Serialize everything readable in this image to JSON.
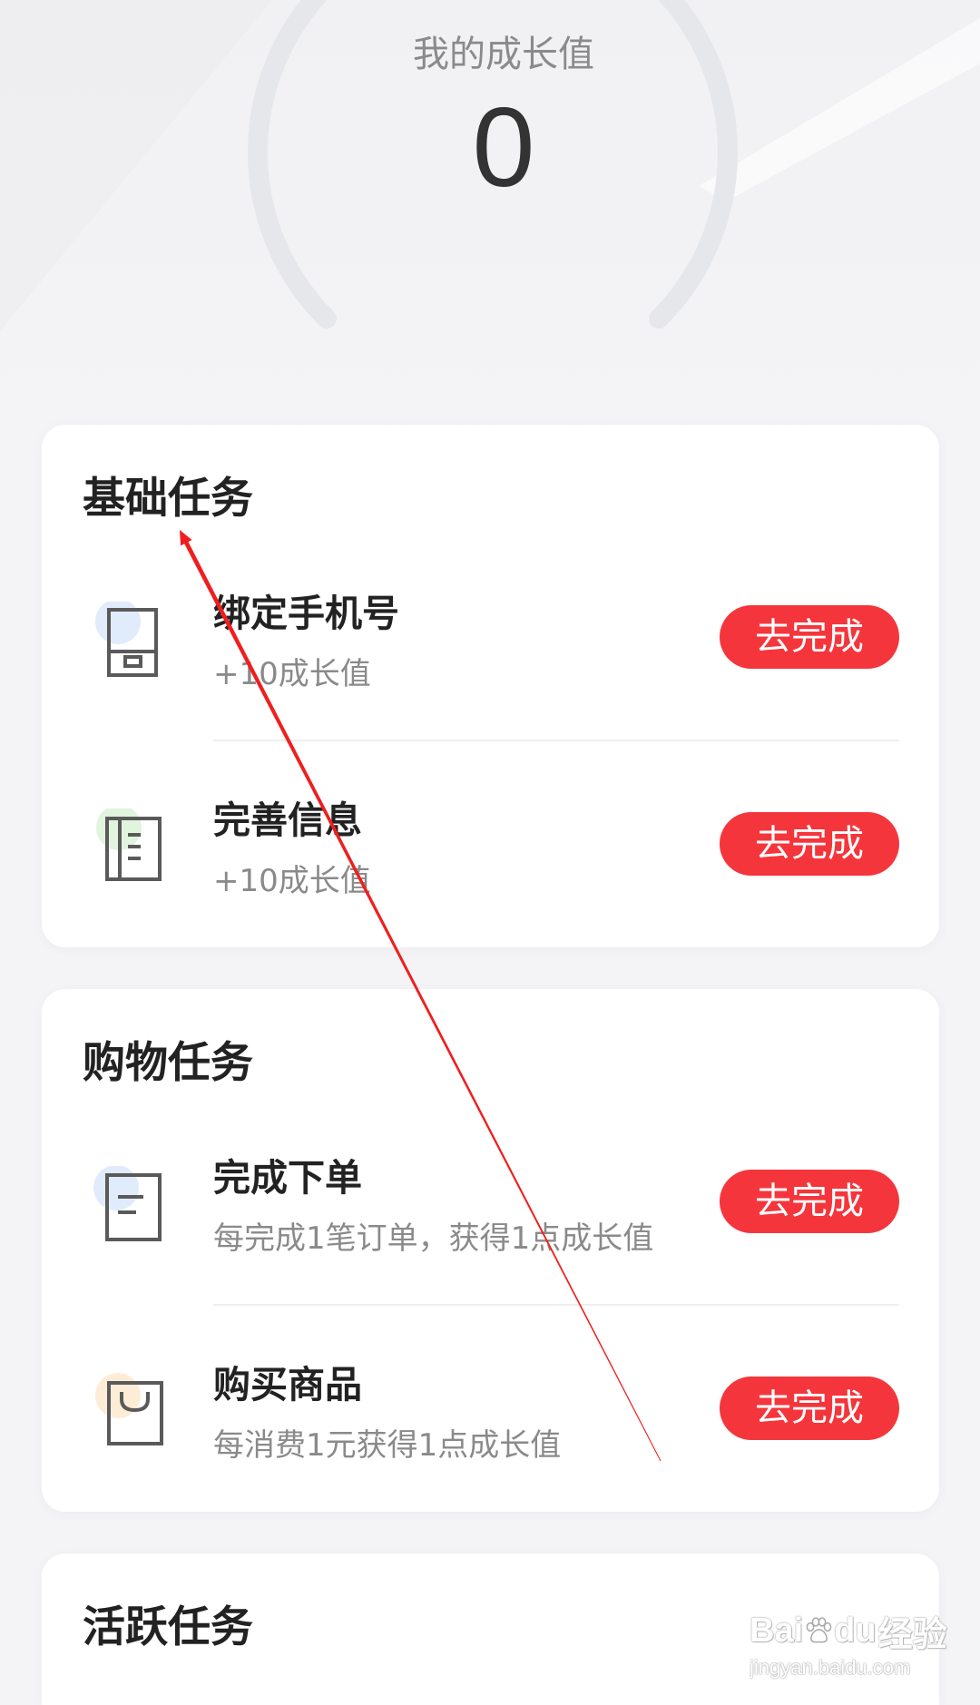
{
  "growth": {
    "label": "我的成长值",
    "value": "0"
  },
  "sections": [
    {
      "title": "基础任务",
      "tasks": [
        {
          "name": "绑定手机号",
          "reward": "+10成长值",
          "action": "去完成",
          "icon": "phone-icon"
        },
        {
          "name": "完善信息",
          "reward": "+10成长值",
          "action": "去完成",
          "icon": "profile-book-icon"
        }
      ]
    },
    {
      "title": "购物任务",
      "tasks": [
        {
          "name": "完成下单",
          "reward": "每完成1笔订单，获得1点成长值",
          "action": "去完成",
          "icon": "order-document-icon"
        },
        {
          "name": "购买商品",
          "reward": "每消费1元获得1点成长值",
          "action": "去完成",
          "icon": "shopping-bag-icon"
        }
      ]
    },
    {
      "title": "活跃任务",
      "tasks": []
    }
  ],
  "colors": {
    "accent": "#f4363c",
    "annotation_arrow": "#ef1f1f",
    "icon_stroke": "#5a5a5a",
    "icon_badge_blue": "#dbe7fb",
    "icon_badge_green": "#dcf2d8",
    "icon_badge_orange": "#fdead0",
    "gauge_track": "#e6e7ea"
  },
  "watermark": {
    "brand_start": "Bai",
    "brand_end": "du",
    "product": "经验",
    "url": "jingyan.baidu.com",
    "icon": "paw-icon"
  }
}
